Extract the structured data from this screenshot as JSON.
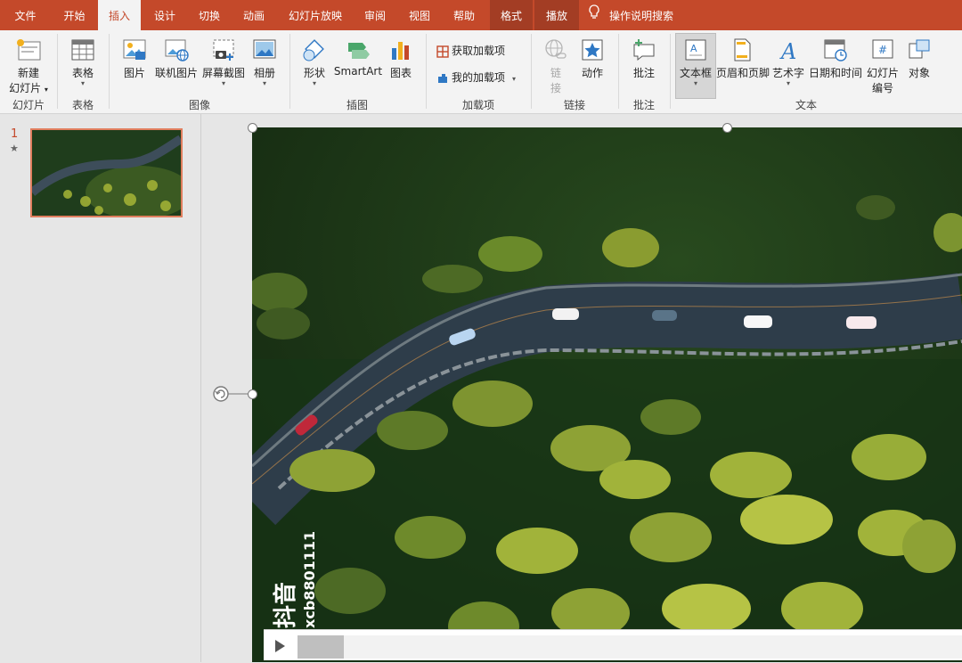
{
  "tabs": [
    {
      "label": "文件",
      "state": "normal"
    },
    {
      "label": "开始",
      "state": "normal"
    },
    {
      "label": "插入",
      "state": "active"
    },
    {
      "label": "设计",
      "state": "normal"
    },
    {
      "label": "切换",
      "state": "normal"
    },
    {
      "label": "动画",
      "state": "normal"
    },
    {
      "label": "幻灯片放映",
      "state": "normal"
    },
    {
      "label": "审阅",
      "state": "normal"
    },
    {
      "label": "视图",
      "state": "normal"
    },
    {
      "label": "帮助",
      "state": "normal"
    },
    {
      "label": "格式",
      "state": "context"
    },
    {
      "label": "播放",
      "state": "context"
    }
  ],
  "tell_me": "操作说明搜索",
  "groups": {
    "slides": {
      "label": "幻灯片",
      "new_slide_1": "新建",
      "new_slide_2": "幻灯片"
    },
    "tables": {
      "label": "表格",
      "table": "表格"
    },
    "images": {
      "label": "图像",
      "picture": "图片",
      "online_picture": "联机图片",
      "screenshot": "屏幕截图",
      "album": "相册"
    },
    "illustrations": {
      "label": "插图",
      "shapes": "形状",
      "smartart": "SmartArt",
      "chart": "图表"
    },
    "addins": {
      "label": "加载项",
      "get_addins": "获取加载项",
      "my_addins": "我的加载项"
    },
    "links": {
      "label": "链接",
      "link_1": "链",
      "link_2": "接",
      "action": "动作"
    },
    "comments": {
      "label": "批注",
      "comment": "批注"
    },
    "text": {
      "label": "文本",
      "textbox": "文本框",
      "header_footer": "页眉和页脚",
      "wordart": "艺术字",
      "datetime": "日期和时间",
      "slide_number_1": "幻灯片",
      "slide_number_2": "编号",
      "object": "对象"
    }
  },
  "slides_panel": {
    "slide_number": "1",
    "star": "★"
  },
  "video": {
    "watermark_app": "抖音",
    "watermark_id": "xcb8801111",
    "progress_fraction": 0.07
  },
  "colors": {
    "accent": "#c4492a",
    "context_tab": "#a33d24",
    "ribbon_bg": "#f3f3f3"
  },
  "icons": [
    "new-slide-icon",
    "table-icon",
    "picture-icon",
    "online-picture-icon",
    "screenshot-icon",
    "album-icon",
    "shapes-icon",
    "smartart-icon",
    "chart-icon",
    "store-icon",
    "my-addins-icon",
    "link-icon",
    "action-icon",
    "comment-icon",
    "textbox-icon",
    "header-footer-icon",
    "wordart-icon",
    "datetime-icon",
    "slide-number-icon",
    "object-icon",
    "lightbulb-icon",
    "rotate-handle-icon",
    "play-icon",
    "tiktok-logo-icon"
  ]
}
